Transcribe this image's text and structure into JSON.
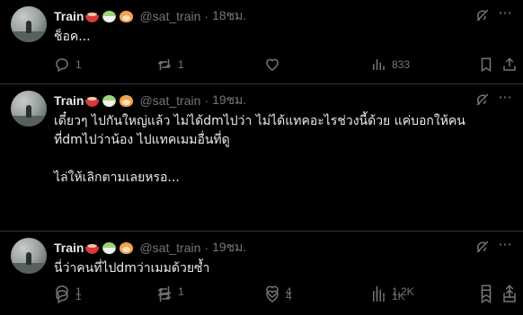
{
  "tweets": [
    {
      "name": "Train",
      "handle": "@sat_train",
      "dot": "·",
      "time": "18ชม.",
      "text": "ช็อค...",
      "replies": "1",
      "retweets": "1",
      "likes": "",
      "views": "833"
    },
    {
      "name": "Train",
      "handle": "@sat_train",
      "dot": "·",
      "time": "19ชม.",
      "text": "เดี๋ยวๆ ไปกันใหญ่แล้ว ไม่ได้dmไปว่า ไม่ได้แทคอะไรช่วงนี้ด้วย แค่บอกให้คนที่dmไปว่าน้อง ไปแทคเมมอื่นที่ดู\n\nไล่ให้เลิกตามเลยหรอ...",
      "replies": "1",
      "retweets": "1",
      "likes": "4",
      "views": "1.2K"
    },
    {
      "name": "Train",
      "handle": "@sat_train",
      "dot": "·",
      "time": "19ชม.",
      "text": "นี่ว่าคนที่ไปdmว่าเมมด้วยซ้ำ",
      "replies": "1",
      "retweets": "",
      "likes": "4",
      "views": "1K"
    }
  ],
  "icons": {
    "reply": "reply-icon",
    "retweet": "retweet-icon",
    "like": "heart-icon",
    "views": "views-icon",
    "bookmark": "bookmark-icon",
    "share": "share-icon",
    "grok": "grok-icon",
    "more": "more-icon"
  },
  "colors": {
    "background": "#000000",
    "text": "#e7e9ea",
    "muted": "#71767b",
    "divider": "#2f3336"
  }
}
